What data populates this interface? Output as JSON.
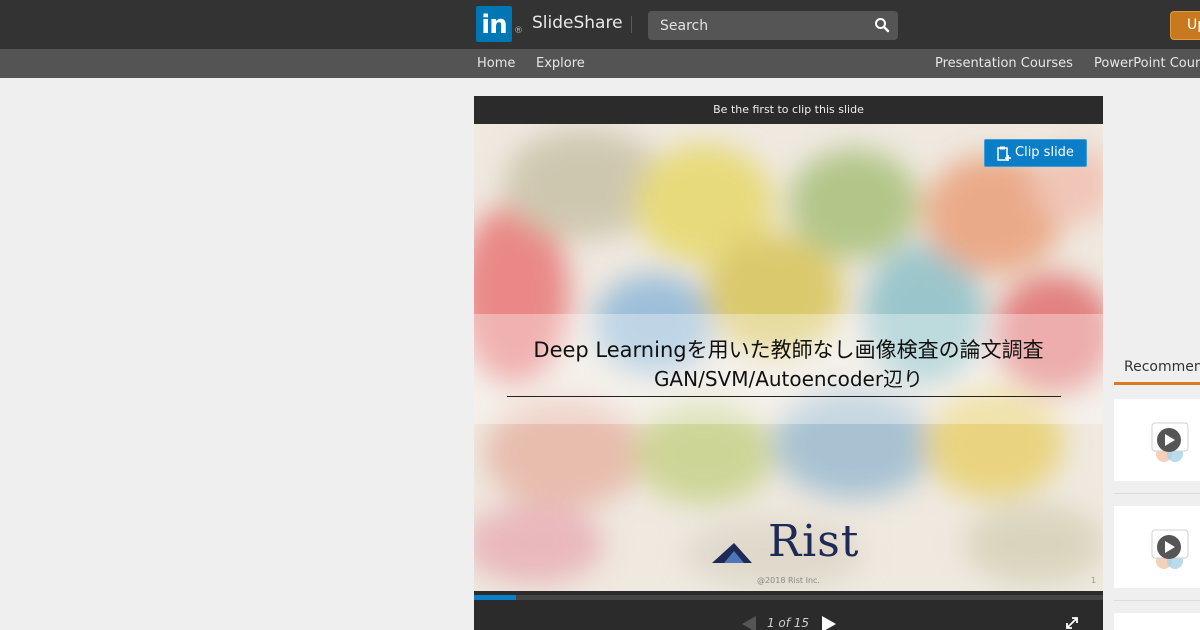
{
  "header": {
    "logo_text": "in",
    "logo_reg": "®",
    "brand": "SlideShare",
    "search_placeholder": "Search",
    "upload_label": "Up"
  },
  "nav": {
    "home": "Home",
    "explore": "Explore",
    "presentation_courses": "Presentation Courses",
    "powerpoint_courses": "PowerPoint Cour"
  },
  "player": {
    "clip_header": "Be the first to clip this slide",
    "clip_button": "Clip slide",
    "slide": {
      "title": "Deep Learningを用いた教師なし画像検査の論文調査",
      "subtitle": "GAN/SVM/Autoencoder辺り",
      "logo_text": "Rist",
      "copyright": "@2018 Rist Inc.",
      "page_mark": "1"
    },
    "progress": 0.066,
    "page_counter": "1 of 15"
  },
  "sidebar": {
    "tab_label": "Recommen"
  },
  "colors": {
    "topbar": "#333333",
    "subnav": "#545454",
    "accent_blue": "#0a7fc7",
    "upload_orange": "#c8781e",
    "tab_underline": "#e07a20"
  }
}
